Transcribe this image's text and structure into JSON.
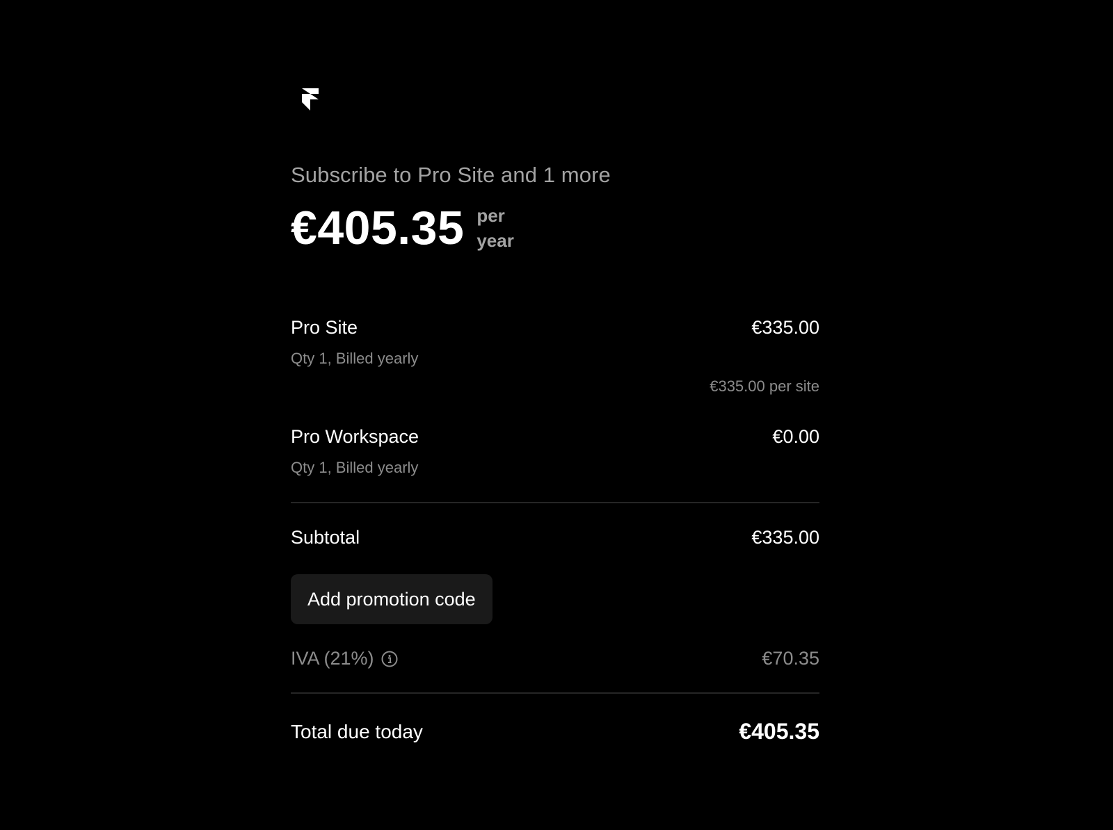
{
  "logo": {
    "icon": "framer-logo-icon"
  },
  "header": {
    "subtitle": "Subscribe to Pro Site and 1 more",
    "price": "€405.35",
    "period_line1": "per",
    "period_line2": "year"
  },
  "items": [
    {
      "name": "Pro Site",
      "amount": "€335.00",
      "detail": "Qty 1, Billed yearly",
      "unit_price": "€335.00 per site"
    },
    {
      "name": "Pro Workspace",
      "amount": "€0.00",
      "detail": "Qty 1, Billed yearly"
    }
  ],
  "subtotal": {
    "label": "Subtotal",
    "amount": "€335.00"
  },
  "promo": {
    "label": "Add promotion code"
  },
  "tax": {
    "label": "IVA (21%)",
    "amount": "€70.35",
    "icon": "info-icon"
  },
  "total": {
    "label": "Total due today",
    "amount": "€405.35"
  },
  "colors": {
    "background": "#000000",
    "primary_text": "#ffffff",
    "secondary_text": "#a3a3a3",
    "muted_text": "#8c8c8c",
    "button_bg": "#1a1a1a",
    "divider": "#262626"
  }
}
